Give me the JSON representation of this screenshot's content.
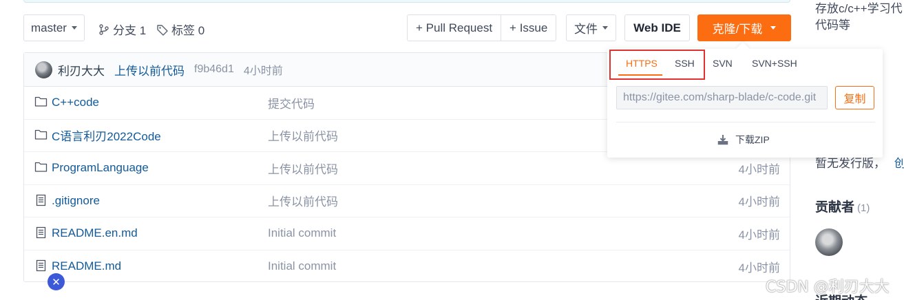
{
  "toolbar": {
    "branch": "master",
    "branches_label": "分支 1",
    "tags_label": "标签 0",
    "pull_request": "+ Pull Request",
    "issue": "+ Issue",
    "files": "文件",
    "web_ide": "Web IDE",
    "clone": "克隆/下载"
  },
  "commit": {
    "author": "利刃大大",
    "message": "上传以前代码",
    "sha": "f9b46d1",
    "time": "4小时前"
  },
  "files": [
    {
      "type": "folder",
      "name": "C++code",
      "message": "提交代码",
      "time": ""
    },
    {
      "type": "folder",
      "name": "C语言利刃2022Code",
      "message": "上传以前代码",
      "time": ""
    },
    {
      "type": "folder",
      "name": "ProgramLanguage",
      "message": "上传以前代码",
      "time": "4小时前"
    },
    {
      "type": "file",
      "name": ".gitignore",
      "message": "上传以前代码",
      "time": "4小时前"
    },
    {
      "type": "file",
      "name": "README.en.md",
      "message": "Initial commit",
      "time": "4小时前"
    },
    {
      "type": "file",
      "name": "README.md",
      "message": "Initial commit",
      "time": "4小时前"
    }
  ],
  "clone_dropdown": {
    "tabs": [
      "HTTPS",
      "SSH",
      "SVN",
      "SVN+SSH"
    ],
    "active_tab": "HTTPS",
    "url": "https://gitee.com/sharp-blade/c-code.git",
    "copy": "复制",
    "download_zip": "下载ZIP"
  },
  "sidebar": {
    "desc_line1": "存放c/c++学习代",
    "desc_line2": "代码等",
    "partial_line": "暂无发行版，",
    "partial_link": "创建",
    "contributors_title": "贡献者",
    "contributors_count": "(1)",
    "bottom_cut": "近期动态"
  },
  "watermark": "CSDN @利刃大大",
  "colors": {
    "accent": "#fc6d12",
    "link": "#125a9a",
    "highlight_box": "#e0312f",
    "bubble": "#3c5ad8"
  }
}
